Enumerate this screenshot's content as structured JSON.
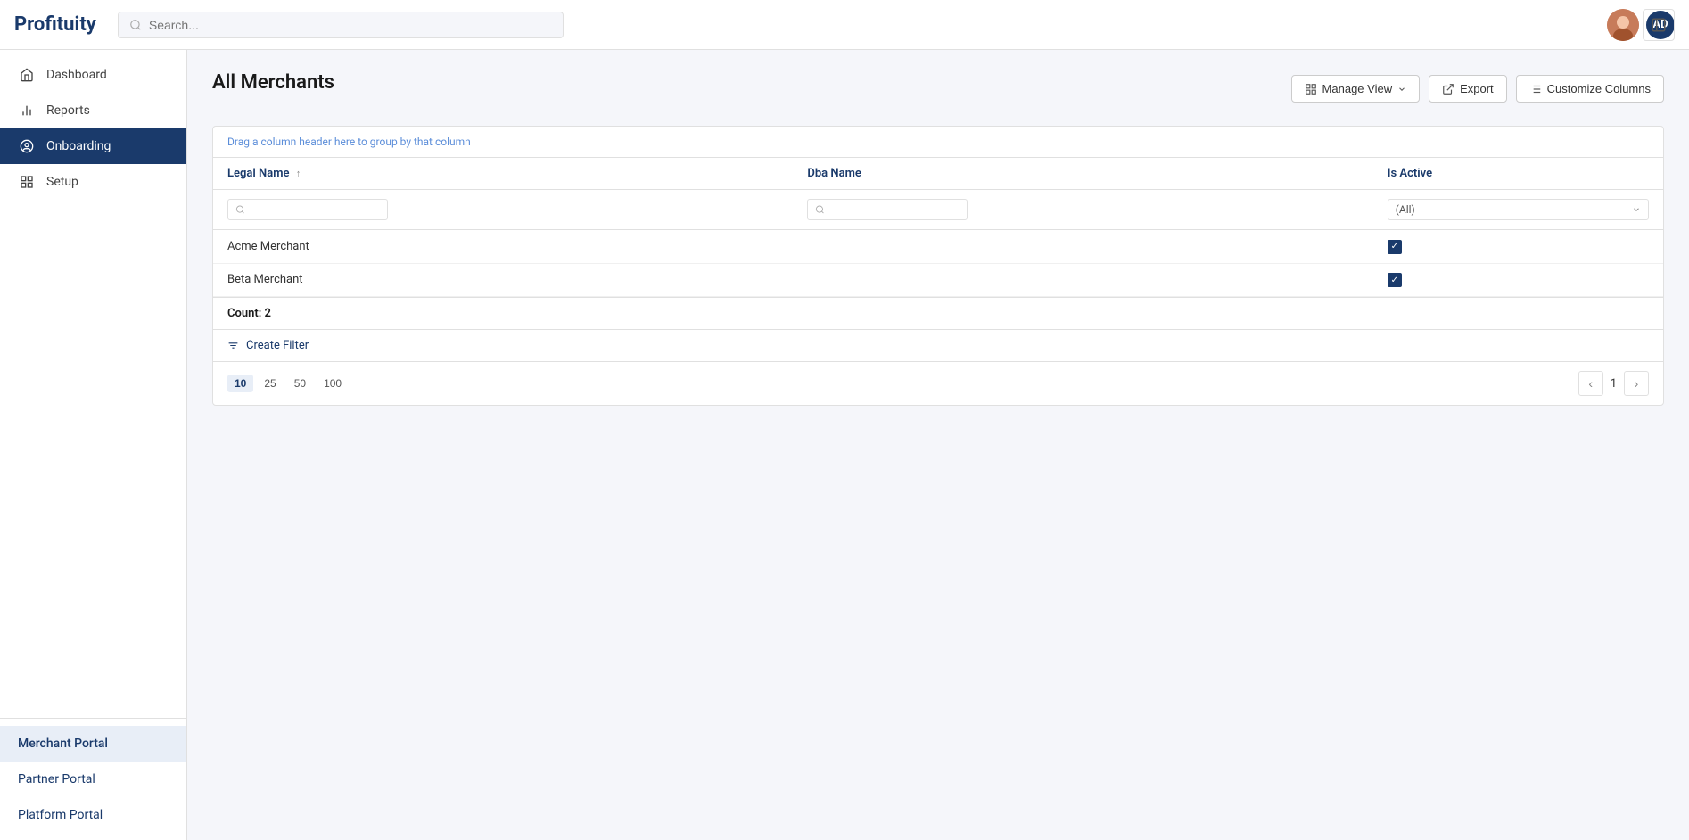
{
  "app": {
    "logo": "Profituity",
    "user_initials": "AD"
  },
  "header": {
    "search_placeholder": "Search..."
  },
  "sidebar": {
    "nav_items": [
      {
        "id": "dashboard",
        "label": "Dashboard",
        "icon": "home"
      },
      {
        "id": "reports",
        "label": "Reports",
        "icon": "bar-chart"
      },
      {
        "id": "onboarding",
        "label": "Onboarding",
        "icon": "user-circle",
        "active": true
      },
      {
        "id": "setup",
        "label": "Setup",
        "icon": "grid"
      }
    ],
    "portals": [
      {
        "id": "merchant-portal",
        "label": "Merchant Portal",
        "active": true
      },
      {
        "id": "partner-portal",
        "label": "Partner Portal",
        "active": false
      },
      {
        "id": "platform-portal",
        "label": "Platform Portal",
        "active": false
      }
    ]
  },
  "main": {
    "page_title": "All Merchants",
    "drag_hint": "Drag a column header here to group by that column",
    "toolbar": {
      "manage_view_label": "Manage View",
      "export_label": "Export",
      "customize_columns_label": "Customize Columns"
    },
    "table": {
      "columns": [
        {
          "id": "legal-name",
          "label": "Legal Name",
          "sortable": true
        },
        {
          "id": "dba-name",
          "label": "Dba Name",
          "sortable": false
        },
        {
          "id": "is-active",
          "label": "Is Active",
          "sortable": false
        }
      ],
      "filter_row": {
        "legal_name_placeholder": "",
        "dba_name_placeholder": "",
        "is_active_value": "(All)"
      },
      "rows": [
        {
          "legal_name": "Acme Merchant",
          "dba_name": "",
          "is_active": true
        },
        {
          "legal_name": "Beta Merchant",
          "dba_name": "",
          "is_active": true
        }
      ],
      "count_label": "Count: 2",
      "create_filter_label": "Create Filter",
      "pagination": {
        "page_sizes": [
          "10",
          "25",
          "50",
          "100"
        ],
        "active_page_size": "10",
        "current_page": "1"
      }
    }
  }
}
